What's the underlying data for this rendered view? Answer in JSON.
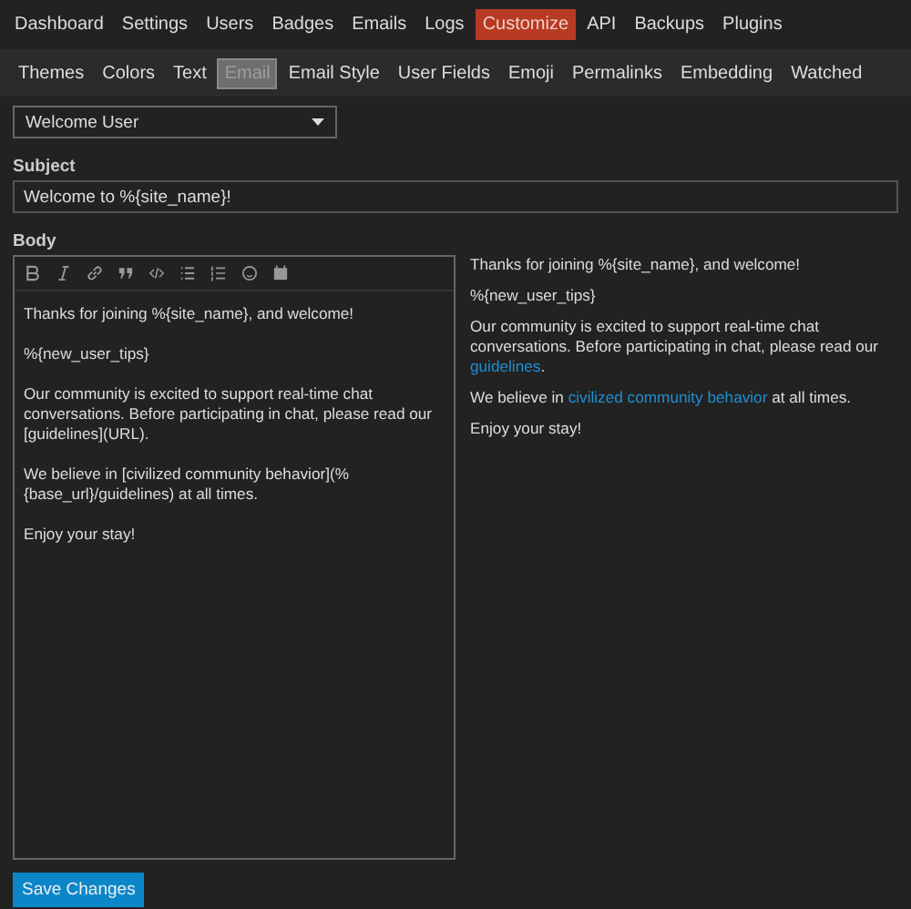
{
  "main_nav": [
    {
      "label": "Dashboard",
      "selected": false
    },
    {
      "label": "Settings",
      "selected": false
    },
    {
      "label": "Users",
      "selected": false
    },
    {
      "label": "Badges",
      "selected": false
    },
    {
      "label": "Emails",
      "selected": false
    },
    {
      "label": "Logs",
      "selected": false
    },
    {
      "label": "Customize",
      "selected": true
    },
    {
      "label": "API",
      "selected": false
    },
    {
      "label": "Backups",
      "selected": false
    },
    {
      "label": "Plugins",
      "selected": false
    }
  ],
  "sub_nav": [
    {
      "label": "Themes",
      "selected": false
    },
    {
      "label": "Colors",
      "selected": false
    },
    {
      "label": "Text",
      "selected": false
    },
    {
      "label": "Email",
      "selected": true
    },
    {
      "label": "Email Style",
      "selected": false
    },
    {
      "label": "User Fields",
      "selected": false
    },
    {
      "label": "Emoji",
      "selected": false
    },
    {
      "label": "Permalinks",
      "selected": false
    },
    {
      "label": "Embedding",
      "selected": false
    },
    {
      "label": "Watched",
      "selected": false
    }
  ],
  "template_select": {
    "value": "Welcome User"
  },
  "subject": {
    "label": "Subject",
    "value": "Welcome to %{site_name}!"
  },
  "body": {
    "label": "Body",
    "toolbar": [
      {
        "kind": "bold"
      },
      {
        "kind": "italic"
      },
      {
        "kind": "link"
      },
      {
        "kind": "quote"
      },
      {
        "kind": "code"
      },
      {
        "kind": "bullet-list"
      },
      {
        "kind": "numbered-list"
      },
      {
        "kind": "emoji"
      },
      {
        "kind": "calendar"
      }
    ],
    "value": "Thanks for joining %{site_name}, and welcome!\n\n%{new_user_tips}\n\nOur community is excited to support real-time chat conversations. Before participating in chat, please read our [guidelines](URL).\n\nWe believe in [civilized community behavior](%{base_url}/guidelines) at all times.\n\nEnjoy your stay!"
  },
  "preview": [
    [
      {
        "text": "Thanks for joining %{site_name}, and welcome!"
      }
    ],
    [
      {
        "text": "%{new_user_tips}"
      }
    ],
    [
      {
        "text": "Our community is excited to support real-time chat conversations. Before participating in chat, please read our "
      },
      {
        "text": "guidelines",
        "link": true
      },
      {
        "text": "."
      }
    ],
    [
      {
        "text": "We believe in "
      },
      {
        "text": "civilized community behavior",
        "link": true
      },
      {
        "text": " at all times."
      }
    ],
    [
      {
        "text": "Enjoy your stay!"
      }
    ]
  ],
  "save_button": "Save Changes"
}
